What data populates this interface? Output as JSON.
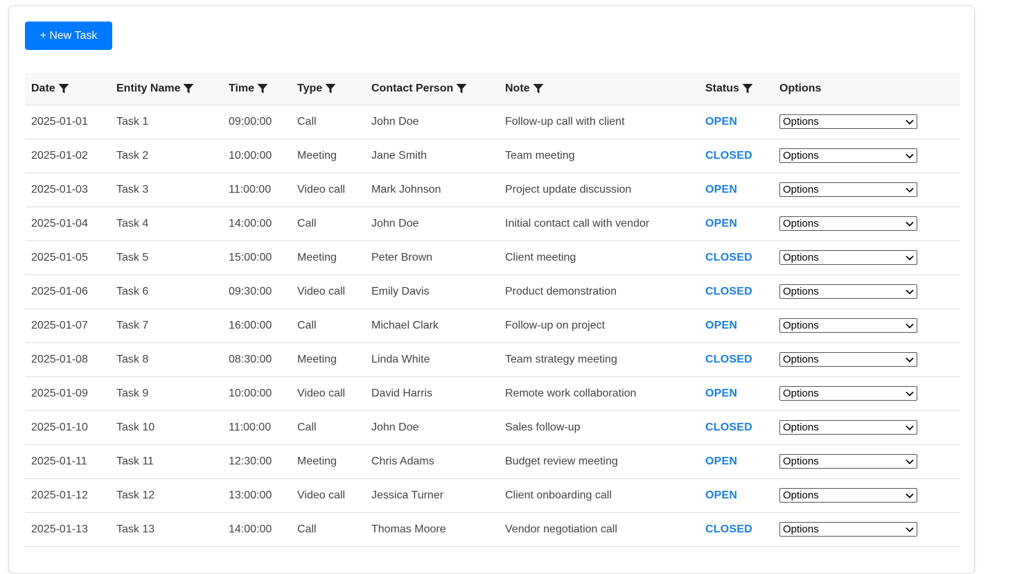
{
  "toolbar": {
    "new_task_label": "+ New Task"
  },
  "table": {
    "columns": [
      {
        "label": "Date",
        "filterable": true
      },
      {
        "label": "Entity Name",
        "filterable": true
      },
      {
        "label": "Time",
        "filterable": true
      },
      {
        "label": "Type",
        "filterable": true
      },
      {
        "label": "Contact Person",
        "filterable": true
      },
      {
        "label": "Note",
        "filterable": true
      },
      {
        "label": "Status",
        "filterable": true
      },
      {
        "label": "Options",
        "filterable": false
      }
    ],
    "rows": [
      {
        "date": "2025-01-01",
        "entity": "Task 1",
        "time": "09:00:00",
        "type": "Call",
        "contact": "John Doe",
        "note": "Follow-up call with client",
        "status": "OPEN",
        "options": "Options"
      },
      {
        "date": "2025-01-02",
        "entity": "Task 2",
        "time": "10:00:00",
        "type": "Meeting",
        "contact": "Jane Smith",
        "note": "Team meeting",
        "status": "CLOSED",
        "options": "Options"
      },
      {
        "date": "2025-01-03",
        "entity": "Task 3",
        "time": "11:00:00",
        "type": "Video call",
        "contact": "Mark Johnson",
        "note": "Project update discussion",
        "status": "OPEN",
        "options": "Options"
      },
      {
        "date": "2025-01-04",
        "entity": "Task 4",
        "time": "14:00:00",
        "type": "Call",
        "contact": "John Doe",
        "note": "Initial contact call with vendor",
        "status": "OPEN",
        "options": "Options"
      },
      {
        "date": "2025-01-05",
        "entity": "Task 5",
        "time": "15:00:00",
        "type": "Meeting",
        "contact": "Peter Brown",
        "note": "Client meeting",
        "status": "CLOSED",
        "options": "Options"
      },
      {
        "date": "2025-01-06",
        "entity": "Task 6",
        "time": "09:30:00",
        "type": "Video call",
        "contact": "Emily Davis",
        "note": "Product demonstration",
        "status": "CLOSED",
        "options": "Options"
      },
      {
        "date": "2025-01-07",
        "entity": "Task 7",
        "time": "16:00:00",
        "type": "Call",
        "contact": "Michael Clark",
        "note": "Follow-up on project",
        "status": "OPEN",
        "options": "Options"
      },
      {
        "date": "2025-01-08",
        "entity": "Task 8",
        "time": "08:30:00",
        "type": "Meeting",
        "contact": "Linda White",
        "note": "Team strategy meeting",
        "status": "CLOSED",
        "options": "Options"
      },
      {
        "date": "2025-01-09",
        "entity": "Task 9",
        "time": "10:00:00",
        "type": "Video call",
        "contact": "David Harris",
        "note": "Remote work collaboration",
        "status": "OPEN",
        "options": "Options"
      },
      {
        "date": "2025-01-10",
        "entity": "Task 10",
        "time": "11:00:00",
        "type": "Call",
        "contact": "John Doe",
        "note": "Sales follow-up",
        "status": "CLOSED",
        "options": "Options"
      },
      {
        "date": "2025-01-11",
        "entity": "Task 11",
        "time": "12:30:00",
        "type": "Meeting",
        "contact": "Chris Adams",
        "note": "Budget review meeting",
        "status": "OPEN",
        "options": "Options"
      },
      {
        "date": "2025-01-12",
        "entity": "Task 12",
        "time": "13:00:00",
        "type": "Video call",
        "contact": "Jessica Turner",
        "note": "Client onboarding call",
        "status": "OPEN",
        "options": "Options"
      },
      {
        "date": "2025-01-13",
        "entity": "Task 13",
        "time": "14:00:00",
        "type": "Call",
        "contact": "Thomas Moore",
        "note": "Vendor negotiation call",
        "status": "CLOSED",
        "options": "Options"
      }
    ]
  },
  "colors": {
    "primary_button": "#007bff",
    "status_text": "#1a7fe6",
    "header_background": "#f7f8fa"
  },
  "icons": {
    "filter": "funnel-icon",
    "dropdown": "chevron-down-icon"
  }
}
